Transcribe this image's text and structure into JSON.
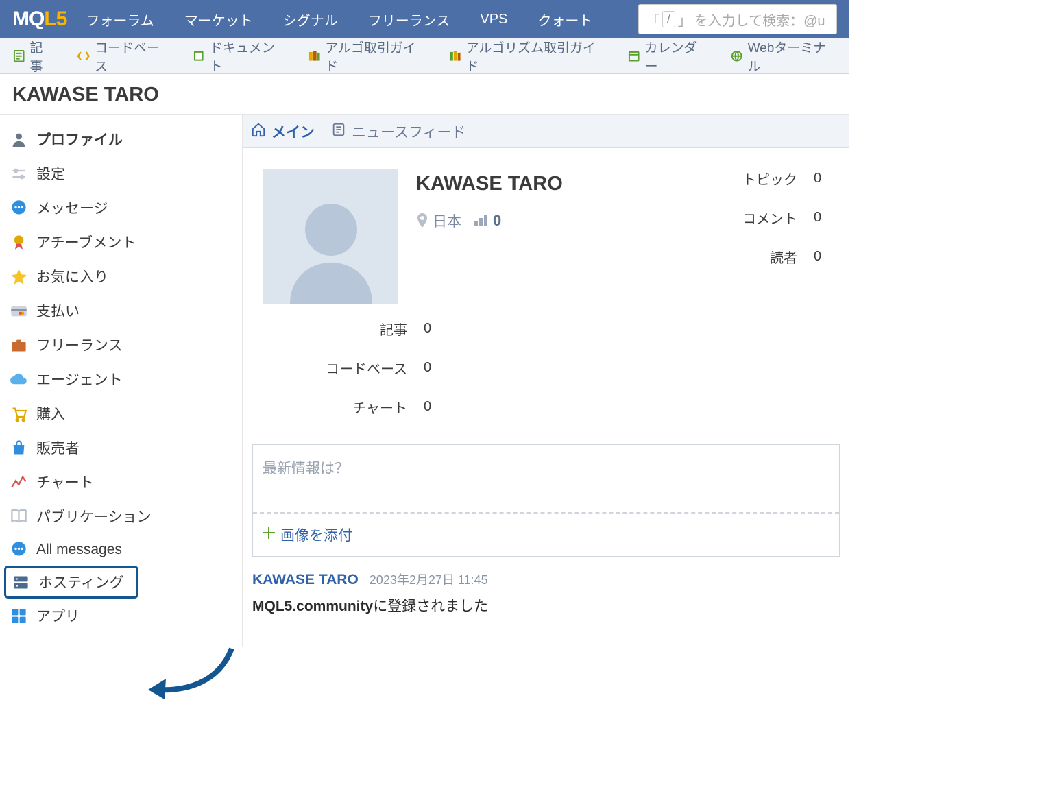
{
  "topnav": {
    "items": [
      "フォーラム",
      "マーケット",
      "シグナル",
      "フリーランス",
      "VPS",
      "クォート"
    ],
    "search_hint": "を入力して検索：@u"
  },
  "secnav": [
    {
      "label": "記事"
    },
    {
      "label": "コードベース"
    },
    {
      "label": "ドキュメント"
    },
    {
      "label": "アルゴ取引ガイド"
    },
    {
      "label": "アルゴリズム取引ガイド"
    },
    {
      "label": "カレンダー"
    },
    {
      "label": "Webターミナル"
    }
  ],
  "page_title": "KAWASE TARO",
  "sidebar": [
    {
      "label": "プロファイル",
      "active": true,
      "icon": "person"
    },
    {
      "label": "設定",
      "icon": "sliders"
    },
    {
      "label": "メッセージ",
      "icon": "chat"
    },
    {
      "label": "アチーブメント",
      "icon": "badge"
    },
    {
      "label": "お気に入り",
      "icon": "star"
    },
    {
      "label": "支払い",
      "icon": "card"
    },
    {
      "label": "フリーランス",
      "icon": "briefcase"
    },
    {
      "label": "エージェント",
      "icon": "cloud"
    },
    {
      "label": "購入",
      "icon": "cart"
    },
    {
      "label": "販売者",
      "icon": "bag"
    },
    {
      "label": "チャート",
      "icon": "chart"
    },
    {
      "label": "パブリケーション",
      "icon": "book"
    },
    {
      "label": "All messages",
      "icon": "chat2"
    },
    {
      "label": "ホスティング",
      "highlight": true,
      "icon": "server"
    },
    {
      "label": "アプリ",
      "icon": "apps"
    }
  ],
  "main_tabs": [
    {
      "label": "メイン",
      "active": true
    },
    {
      "label": "ニュースフィード"
    }
  ],
  "profile": {
    "name": "KAWASE TARO",
    "location": "日本",
    "rank": "0",
    "stats_right": [
      {
        "label": "トピック",
        "val": "0"
      },
      {
        "label": "コメント",
        "val": "0"
      },
      {
        "label": "読者",
        "val": "0"
      }
    ],
    "stats_left": [
      {
        "label": "記事",
        "val": "0"
      },
      {
        "label": "コードベース",
        "val": "0"
      },
      {
        "label": "チャート",
        "val": "0"
      }
    ]
  },
  "composer": {
    "placeholder": "最新情報は？",
    "attach": "画像を添付"
  },
  "feed": {
    "user": "KAWASE TARO",
    "date": "2023年2月27日 11:45",
    "text_bold": "MQL5.community",
    "text_rest": "に登録されました"
  }
}
